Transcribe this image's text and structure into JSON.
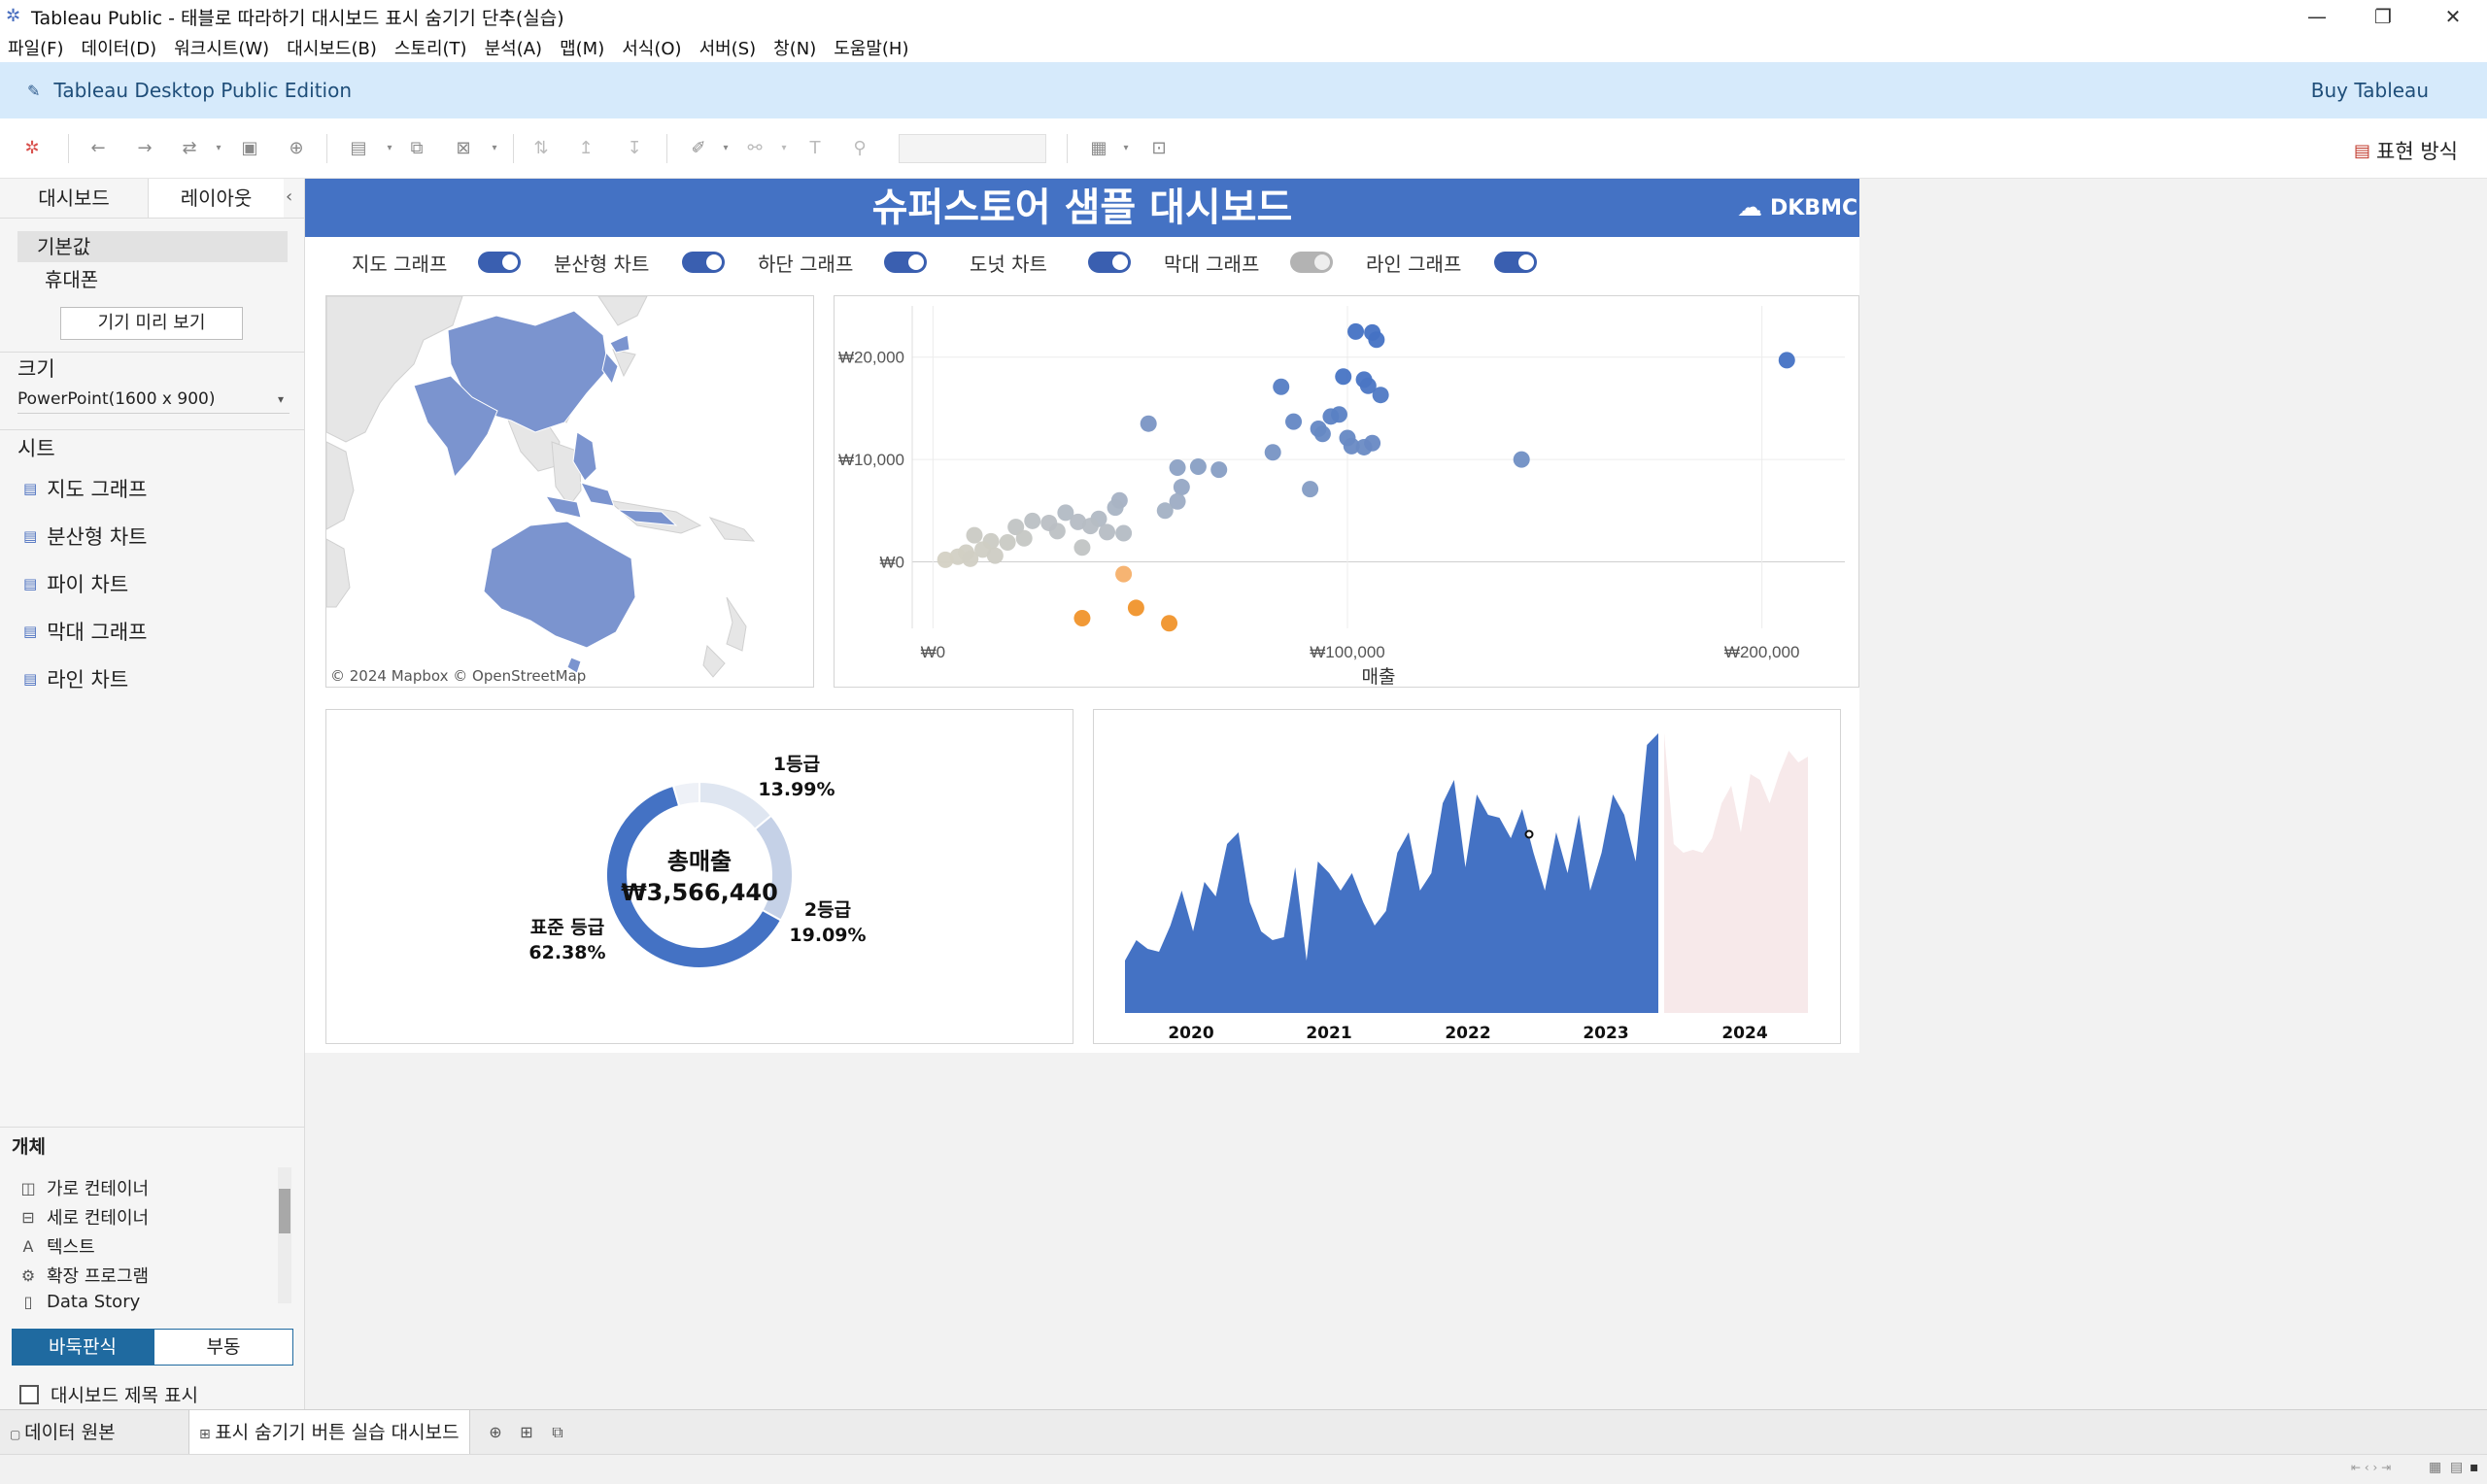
{
  "window": {
    "title": "Tableau Public - 태블로 따라하기 대시보드 표시 숨기기 단추(실습)",
    "minimize": "—",
    "restore": "❐",
    "close": "✕"
  },
  "menu": [
    "파일(F)",
    "데이터(D)",
    "워크시트(W)",
    "대시보드(B)",
    "스토리(T)",
    "분석(A)",
    "맵(M)",
    "서식(O)",
    "서버(S)",
    "창(N)",
    "도움말(H)"
  ],
  "banner": {
    "edition": "Tableau Desktop Public Edition",
    "buy": "Buy Tableau"
  },
  "toolbar": {
    "show_me": "표현 방식"
  },
  "left_panel": {
    "tabs": {
      "dashboard": "대시보드",
      "layout": "레이아웃"
    },
    "devices": {
      "default": "기본값",
      "phone": "휴대폰"
    },
    "preview_button": "기기 미리 보기",
    "size": {
      "title": "크기",
      "value": "PowerPoint(1600 x 900)"
    },
    "sheets": {
      "title": "시트",
      "items": [
        "지도 그래프",
        "분산형 차트",
        "파이 차트",
        "막대 그래프",
        "라인 차트"
      ]
    },
    "objects": {
      "title": "개체",
      "items": [
        "가로 컨테이너",
        "세로 컨테이너",
        "텍스트",
        "확장 프로그램",
        "Data Story"
      ]
    },
    "layout_mode": {
      "tiled": "바둑판식",
      "floating": "부동"
    },
    "show_title": "대시보드 제목 표시"
  },
  "dashboard": {
    "title": "슈퍼스토어 샘플 대시보드",
    "logo": "DKBMC",
    "header_color": "#4472c4",
    "toggles": [
      {
        "label": "지도 그래프",
        "on": true
      },
      {
        "label": "분산형 차트",
        "on": true
      },
      {
        "label": "하단 그래프",
        "on": true
      },
      {
        "label": "도넛 차트",
        "on": true
      },
      {
        "label": "막대 그래프",
        "on": false
      },
      {
        "label": "라인 그래프",
        "on": true
      }
    ],
    "map": {
      "attribution": "© 2024 Mapbox © OpenStreetMap"
    }
  },
  "chart_data": [
    {
      "type": "scatter",
      "title": "",
      "xlabel": "매출",
      "ylabel": "",
      "xlim": [
        -5000,
        220000
      ],
      "ylim": [
        -6500,
        25000
      ],
      "xticks": [
        "₩0",
        "₩100,000",
        "₩200,000"
      ],
      "yticks": [
        "₩0",
        "₩10,000",
        "₩20,000"
      ],
      "grid": true,
      "points": [
        [
          102000,
          22500
        ],
        [
          106000,
          22400
        ],
        [
          107000,
          21700
        ],
        [
          84000,
          17100
        ],
        [
          99000,
          18100
        ],
        [
          104000,
          17800
        ],
        [
          108000,
          16300
        ],
        [
          105000,
          17200
        ],
        [
          87000,
          13700
        ],
        [
          52000,
          13500
        ],
        [
          96000,
          14200
        ],
        [
          93000,
          13000
        ],
        [
          98000,
          14400
        ],
        [
          94000,
          12500
        ],
        [
          100000,
          12100
        ],
        [
          101000,
          11300
        ],
        [
          104000,
          11200
        ],
        [
          106000,
          11600
        ],
        [
          82000,
          10700
        ],
        [
          142000,
          10000
        ],
        [
          206000,
          19700
        ],
        [
          59000,
          9200
        ],
        [
          64000,
          9300
        ],
        [
          69000,
          9000
        ],
        [
          60000,
          7300
        ],
        [
          59000,
          5900
        ],
        [
          91000,
          7100
        ],
        [
          45000,
          6000
        ],
        [
          44000,
          5300
        ],
        [
          56000,
          5000
        ],
        [
          32000,
          4800
        ],
        [
          35000,
          3900
        ],
        [
          40000,
          4200
        ],
        [
          42000,
          2900
        ],
        [
          46000,
          2800
        ],
        [
          30000,
          3000
        ],
        [
          38000,
          3500
        ],
        [
          28000,
          3800
        ],
        [
          24000,
          4000
        ],
        [
          20000,
          3400
        ],
        [
          22000,
          2300
        ],
        [
          18000,
          1900
        ],
        [
          10000,
          2600
        ],
        [
          14000,
          2000
        ],
        [
          12000,
          1200
        ],
        [
          8000,
          900
        ],
        [
          6000,
          500
        ],
        [
          3000,
          200
        ],
        [
          9000,
          300
        ],
        [
          15000,
          600
        ],
        [
          36000,
          1400
        ],
        [
          46000,
          -1200
        ],
        [
          36000,
          -5500
        ],
        [
          49000,
          -4500
        ],
        [
          57000,
          -6000
        ]
      ]
    },
    {
      "type": "pie",
      "title": "총매출",
      "center_value": "₩3,566,440",
      "slices": [
        {
          "label": "1등급",
          "value": 13.99,
          "text": "13.99%",
          "color": "#dfe6f1"
        },
        {
          "label": "2등급",
          "value": 19.09,
          "text": "19.09%",
          "color": "#c5d1e7"
        },
        {
          "label": "표준 등급",
          "value": 62.38,
          "text": "62.38%",
          "color": "#4472c4"
        },
        {
          "label": "",
          "value": 4.54,
          "text": "",
          "color": "#eef1f7"
        }
      ]
    },
    {
      "type": "area",
      "title": "",
      "xticks": [
        "2020",
        "2021",
        "2022",
        "2023",
        "2024"
      ],
      "series": [
        {
          "name": "",
          "color": "#4472c4",
          "values": [
            18,
            25,
            22,
            21,
            30,
            42,
            28,
            45,
            40,
            58,
            62,
            38,
            28,
            25,
            26,
            50,
            18,
            52,
            48,
            42,
            48,
            38,
            30,
            35,
            55,
            62,
            42,
            48,
            72,
            80,
            50,
            75,
            68,
            67,
            60,
            70,
            55,
            42,
            62,
            48,
            68,
            42,
            55,
            75,
            68,
            52,
            92,
            96
          ]
        },
        {
          "name": "",
          "color": "#f7e9ea",
          "values": [
            96,
            58,
            55,
            56,
            55,
            60,
            72,
            78,
            62,
            82,
            80,
            72,
            82,
            90,
            86,
            88
          ]
        }
      ]
    }
  ]
}
